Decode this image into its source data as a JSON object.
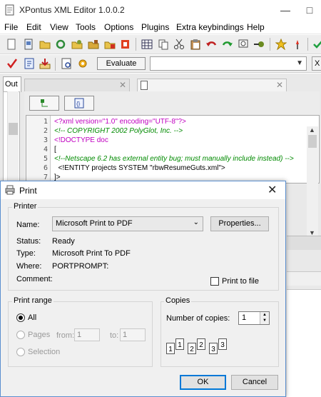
{
  "window": {
    "title": "XPontus XML Editor 1.0.0.2"
  },
  "menu": [
    "File",
    "Edit",
    "View",
    "Tools",
    "Options",
    "Plugins",
    "Extra keybindings",
    "Help"
  ],
  "toolbar": {
    "evaluate_label": "Evaluate",
    "x_label": "X"
  },
  "left_panel": {
    "tab_label": "Out"
  },
  "code_lines": [
    {
      "n": "1",
      "text": "<?xml version=\"1.0\" encoding=\"UTF-8\"?>",
      "kind": "pi"
    },
    {
      "n": "2",
      "text": "<!-- COPYRIGHT 2002 PolyGlot, Inc. -->",
      "kind": "comment"
    },
    {
      "n": "3",
      "text": "<!DOCTYPE doc",
      "kind": "decl"
    },
    {
      "n": "4",
      "text": "[",
      "kind": "plain"
    },
    {
      "n": "5",
      "text": "<!--Netscape 6.2 has external entity bug; must manually include instead) -->",
      "kind": "comment"
    },
    {
      "n": "6",
      "text": "  <!ENTITY projects SYSTEM \"rbwResumeGuts.xml\">",
      "kind": "plain"
    },
    {
      "n": "7",
      "text": "]>",
      "kind": "plain"
    }
  ],
  "dialog": {
    "title": "Print",
    "printer_group": "Printer",
    "name_label": "Name:",
    "printer_name": "Microsoft Print to PDF",
    "properties_label": "Properties...",
    "status_label": "Status:",
    "status_value": "Ready",
    "type_label": "Type:",
    "type_value": "Microsoft Print To PDF",
    "where_label": "Where:",
    "where_value": "PORTPROMPT:",
    "comment_label": "Comment:",
    "print_to_file_label": "Print to file",
    "range_group": "Print range",
    "all_label": "All",
    "pages_label": "Pages",
    "from_label": "from:",
    "from_value": "1",
    "to_label": "to:",
    "to_value": "1",
    "selection_label": "Selection",
    "copies_group": "Copies",
    "copies_label": "Number of copies:",
    "copies_value": "1",
    "collate_pages": [
      "1",
      "1",
      "2",
      "2",
      "3",
      "3"
    ],
    "ok_label": "OK",
    "cancel_label": "Cancel"
  }
}
